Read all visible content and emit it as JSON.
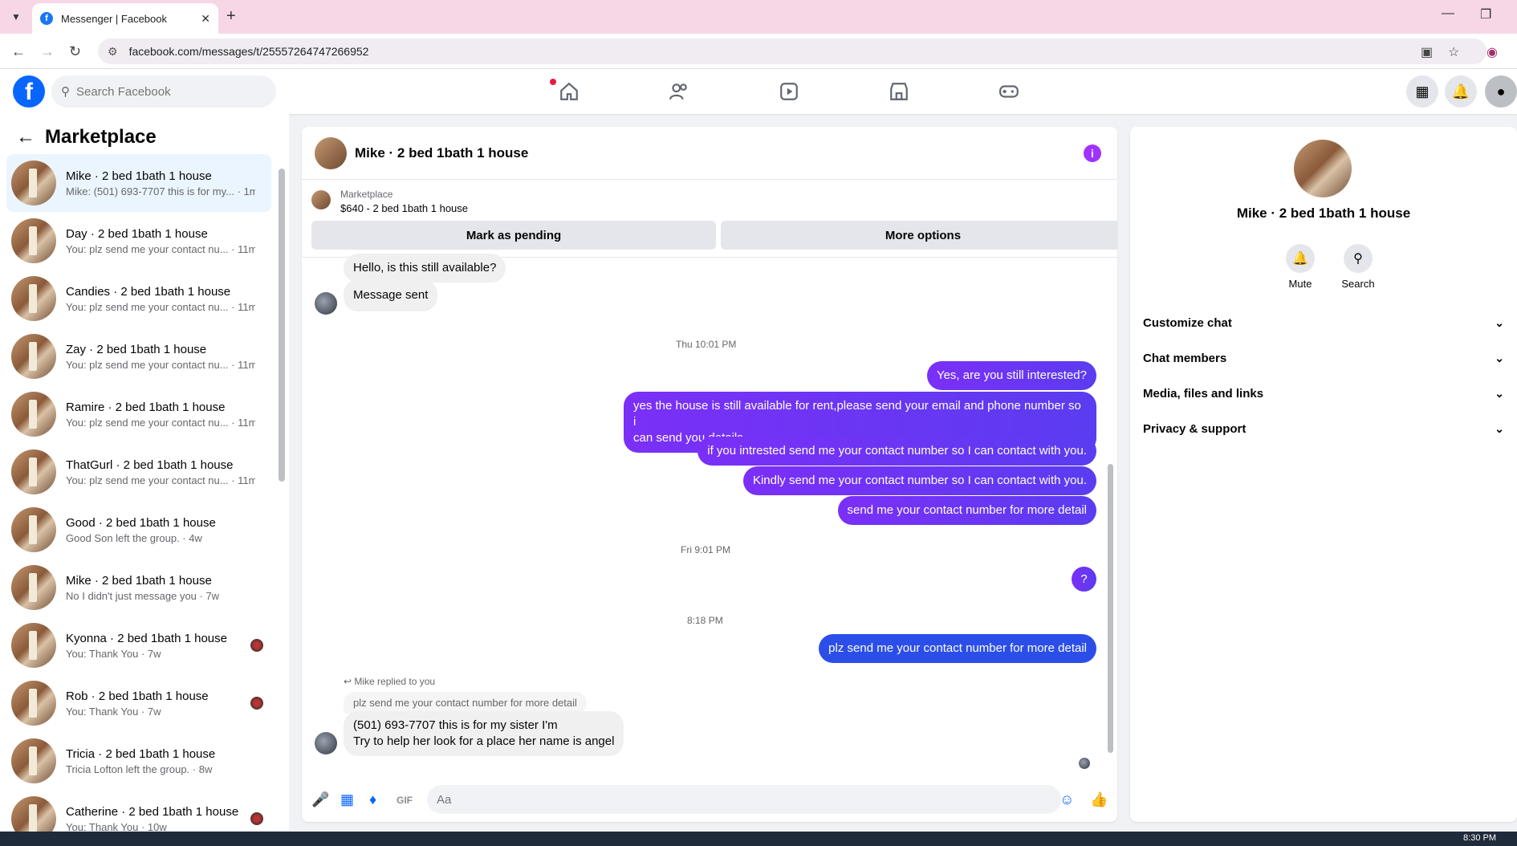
{
  "browser": {
    "tab_title": "Messenger | Facebook",
    "url": "facebook.com/messages/t/25557264747266952"
  },
  "fb": {
    "search_placeholder": "Search Facebook"
  },
  "left": {
    "title": "Marketplace",
    "conversations": [
      {
        "name": "Mike · 2 bed 1bath 1 house",
        "snippet": "Mike: (501) 693-7707 this is for my... · 1m",
        "active": true
      },
      {
        "name": "Day · 2 bed 1bath 1 house",
        "snippet": "You: plz send me your contact nu... · 11m"
      },
      {
        "name": "Candies · 2 bed 1bath 1 house",
        "snippet": "You: plz send me your contact nu... · 11m"
      },
      {
        "name": "Zay · 2 bed 1bath 1 house",
        "snippet": "You: plz send me your contact nu... · 11m"
      },
      {
        "name": "Ramire · 2 bed 1bath 1 house",
        "snippet": "You: plz send me your contact nu... · 11m"
      },
      {
        "name": "ThatGurl · 2 bed 1bath 1 house",
        "snippet": "You: plz send me your contact nu... · 11m"
      },
      {
        "name": "Good · 2 bed 1bath 1 house",
        "snippet": "Good Son left the group. · 4w"
      },
      {
        "name": "Mike · 2 bed 1bath 1 house",
        "snippet": "No I didn't just message you · 7w"
      },
      {
        "name": "Kyonna · 2 bed 1bath 1 house",
        "snippet": "You: Thank You · 7w"
      },
      {
        "name": "Rob · 2 bed 1bath 1 house",
        "snippet": "You: Thank You · 7w"
      },
      {
        "name": "Tricia · 2 bed 1bath 1 house",
        "snippet": "Tricia Lofton left the group. · 8w"
      },
      {
        "name": "Catherine · 2 bed 1bath 1 house",
        "snippet": "You: Thank You · 10w"
      }
    ]
  },
  "chat": {
    "title": "Mike · 2 bed 1bath 1 house",
    "listing_label": "Marketplace",
    "listing_price": "$640 - 2 bed 1bath 1 house",
    "mark_pending": "Mark as pending",
    "more_options": "More options",
    "msg_in_1": "Hello, is this still available?",
    "msg_in_2": "Message sent",
    "stamp_1": "Thu 10:01 PM",
    "msg_out_1": "Yes, are you still interested?",
    "msg_out_2a": "yes the house is still available for rent,please send your email and phone number so i",
    "msg_out_2b": "can send you details",
    "msg_out_3": "if you intrested send me your contact number so I can contact with you.",
    "msg_out_4": "Kindly send me your contact number so I can contact with you.",
    "msg_out_5": "send me your contact number for more detail",
    "stamp_2": "Fri 9:01 PM",
    "msg_out_6": "?",
    "stamp_3": "8:18 PM",
    "msg_out_7": "plz send me your contact number for more detail",
    "reply_hint": "Mike replied to you",
    "quoted": "plz send me your contact number for more detail",
    "msg_in_3a": "(501) 693-7707 this is for my sister I'm",
    "msg_in_3b": "Try to help her look for a place her name is angel",
    "composer_placeholder": "Aa"
  },
  "right": {
    "name": "Mike · 2 bed 1bath 1 house",
    "mute": "Mute",
    "search": "Search",
    "rows": [
      "Customize chat",
      "Chat members",
      "Media, files and links",
      "Privacy & support"
    ]
  },
  "taskbar": {
    "clock": "8:30 PM"
  },
  "colors": {
    "accent": "#0866ff",
    "outgoing": "#7b2ff7",
    "info": "#a033ff"
  }
}
